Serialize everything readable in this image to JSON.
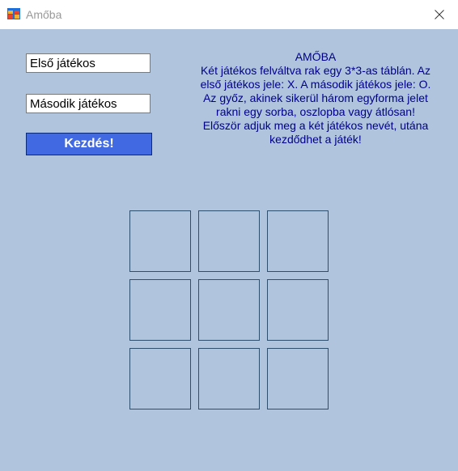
{
  "window": {
    "title": "Amőba",
    "icon": "app-window-icon",
    "close_icon": "close-icon"
  },
  "form": {
    "player1_value": "Első játékos",
    "player2_value": "Második játékos",
    "start_label": "Kezdés!"
  },
  "info": {
    "heading": "AMŐBA",
    "lines": [
      "Két játékos felváltva rak egy 3*3-as táblán. Az",
      "első játékos jele: X. A második játékos jele: O.",
      "Az győz, akinek sikerül három egyforma jelet",
      "rakni egy sorba, oszlopba vagy átlósan!",
      "Először adjuk meg a két játékos nevét, utána",
      "kezdődhet a játék!"
    ]
  },
  "board": {
    "cells": [
      "",
      "",
      "",
      "",
      "",
      "",
      "",
      "",
      ""
    ]
  },
  "colors": {
    "background": "#b0c4de",
    "button": "#4169e1",
    "info_text": "#00008b"
  }
}
